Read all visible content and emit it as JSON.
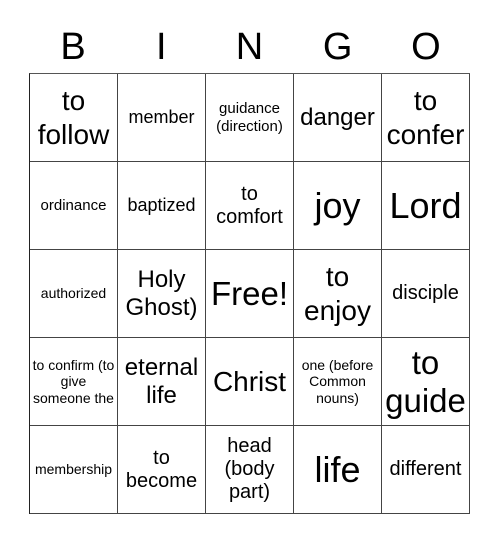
{
  "header": [
    "B",
    "I",
    "N",
    "G",
    "O"
  ],
  "cells": [
    [
      "to follow",
      "member",
      "guidance (direction)",
      "danger",
      "to confer"
    ],
    [
      "ordinance",
      "baptized",
      "to comfort",
      "joy",
      "Lord"
    ],
    [
      "authorized",
      "Holy Ghost)",
      "Free!",
      "to enjoy",
      "disciple"
    ],
    [
      "to confirm (to give someone the",
      "eternal life",
      "Christ",
      "one (before Common nouns)",
      "to guide"
    ],
    [
      "membership",
      "to become",
      "head (body part)",
      "life",
      "different"
    ]
  ]
}
